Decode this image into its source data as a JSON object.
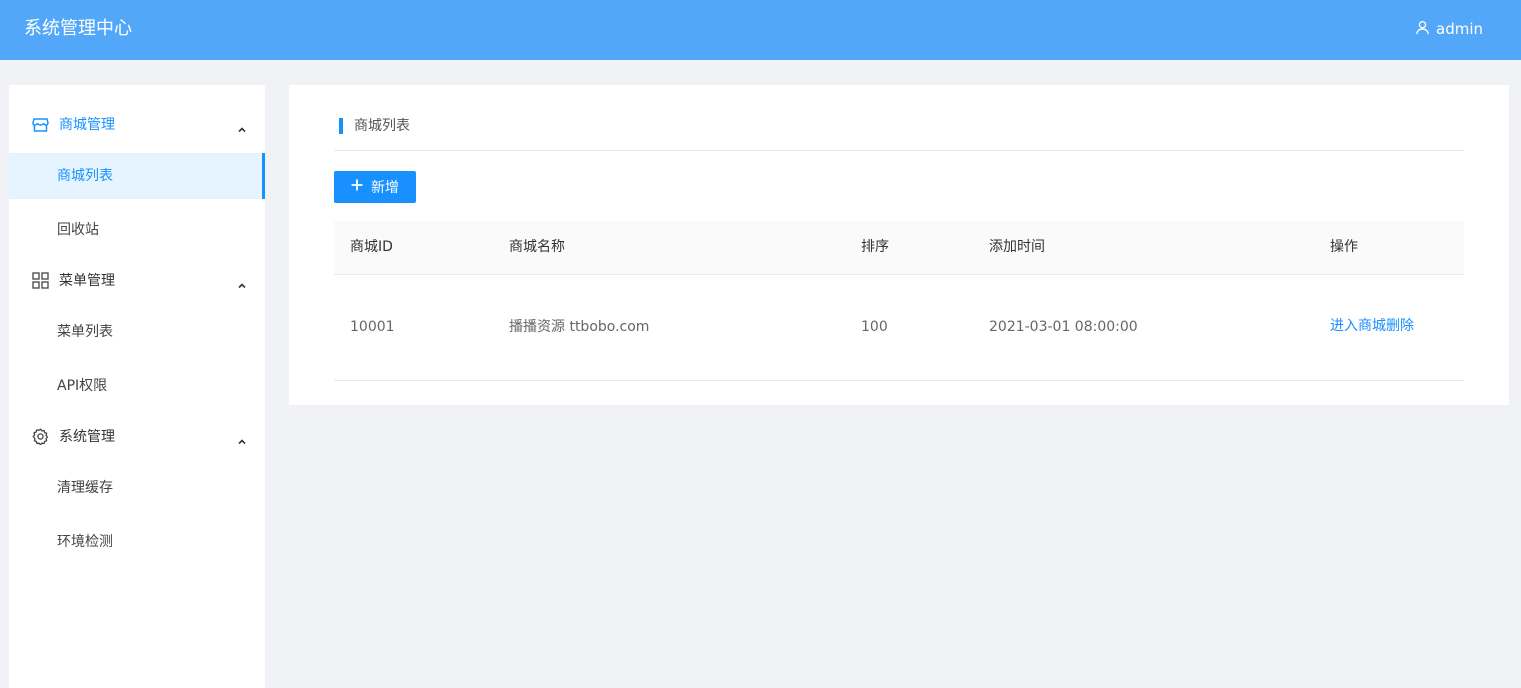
{
  "header": {
    "title": "系统管理中心",
    "user": {
      "icon": "user-icon",
      "name": "admin"
    }
  },
  "sidebar": {
    "groups": [
      {
        "label": "商城管理",
        "icon": "store-icon",
        "expanded": true,
        "items": [
          {
            "label": "商城列表",
            "active": true
          },
          {
            "label": "回收站"
          }
        ]
      },
      {
        "label": "菜单管理",
        "icon": "grid-icon",
        "expanded": true,
        "items": [
          {
            "label": "菜单列表"
          },
          {
            "label": "API权限"
          }
        ]
      },
      {
        "label": "系统管理",
        "icon": "gear-icon",
        "expanded": true,
        "items": [
          {
            "label": "清理缓存"
          },
          {
            "label": "环境检测"
          }
        ]
      }
    ]
  },
  "main": {
    "section_title": "商城列表",
    "add_label": "新增",
    "table": {
      "columns": [
        "商城ID",
        "商城名称",
        "排序",
        "添加时间",
        "操作"
      ],
      "rows": [
        {
          "id": "10001",
          "name": "播播资源 ttbobo.com",
          "sort": "100",
          "time": "2021-03-01 08:00:00",
          "actions": [
            "进入商城",
            "删除"
          ]
        }
      ]
    }
  },
  "colors": {
    "header": "#52a7f8",
    "accent": "#1890ff",
    "background": "#f0f2f5"
  }
}
